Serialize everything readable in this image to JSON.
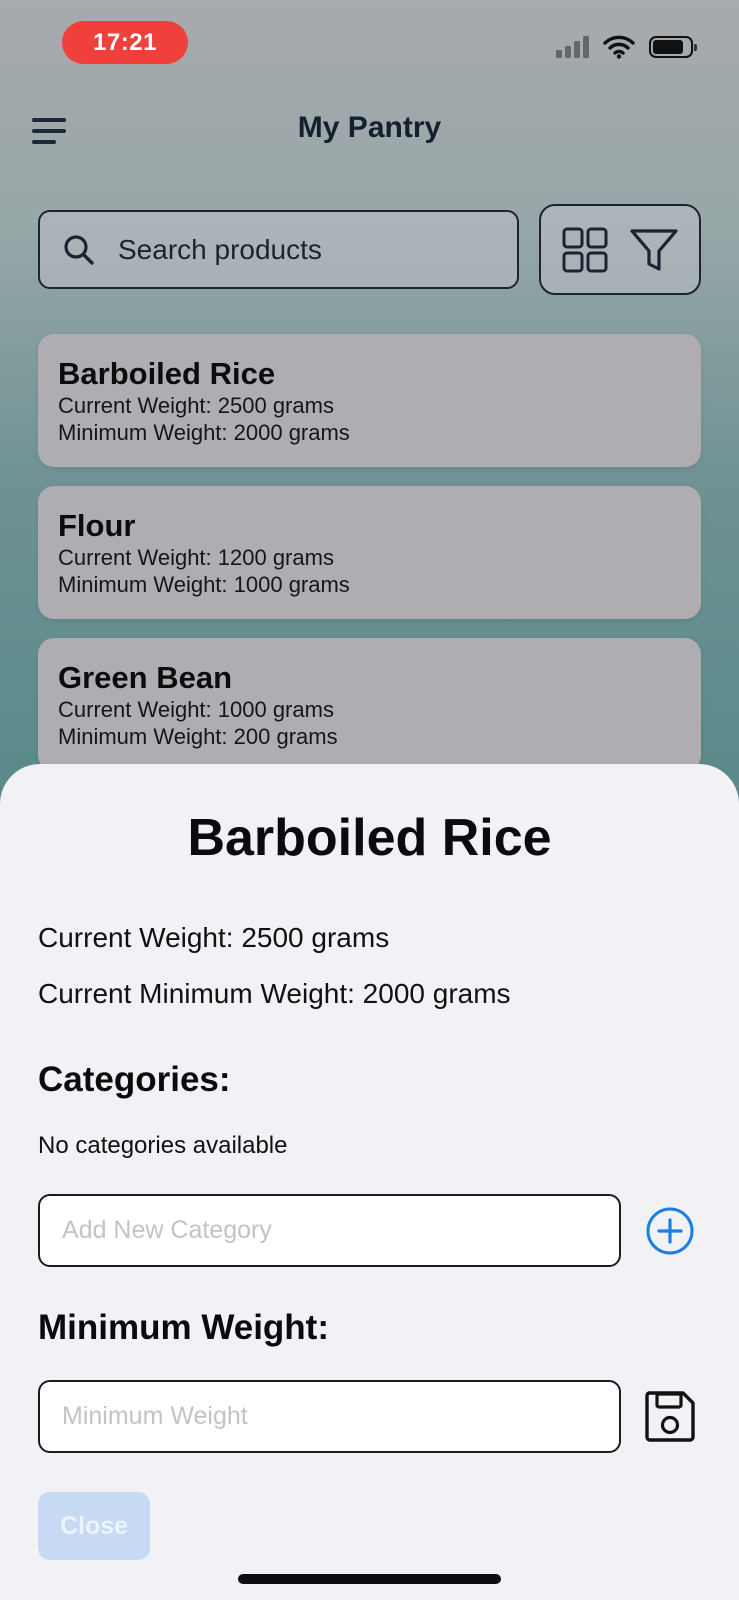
{
  "status_bar": {
    "time": "17:21",
    "time_pill_color": "#f0403b"
  },
  "nav": {
    "title": "My Pantry"
  },
  "search": {
    "placeholder": "Search products"
  },
  "products": [
    {
      "name": "Barboiled Rice",
      "current": "Current Weight: 2500 grams",
      "minimum": "Minimum Weight: 2000 grams"
    },
    {
      "name": "Flour",
      "current": "Current Weight: 1200 grams",
      "minimum": "Minimum Weight: 1000 grams"
    },
    {
      "name": "Green Bean",
      "current": "Current Weight: 1000 grams",
      "minimum": "Minimum Weight: 200 grams"
    }
  ],
  "sheet": {
    "title": "Barboiled Rice",
    "current_weight": "Current Weight: 2500 grams",
    "current_minimum_weight": "Current Minimum Weight: 2000 grams",
    "categories_heading": "Categories:",
    "no_categories": "No categories available",
    "category_placeholder": "Add New Category",
    "minimum_heading": "Minimum Weight:",
    "minimum_placeholder": "Minimum Weight",
    "close_label": "Close"
  },
  "colors": {
    "accent": "#1a7fe0",
    "close_button_bg": "#c6daf3"
  },
  "icons": [
    "menu-icon",
    "search-icon",
    "grid-view-icon",
    "filter-icon",
    "add-circle-icon",
    "save-icon"
  ]
}
